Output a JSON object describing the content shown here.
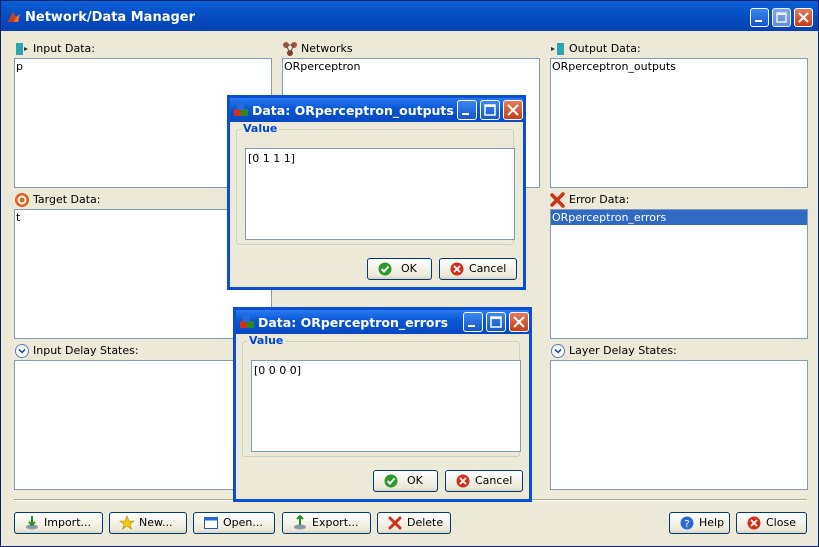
{
  "window": {
    "title": "Network/Data Manager"
  },
  "panels": {
    "input_data": {
      "label": "Input Data:",
      "items": [
        "p"
      ]
    },
    "networks": {
      "label": "Networks",
      "items": [
        "ORperceptron"
      ]
    },
    "output_data": {
      "label": "Output Data:",
      "items": [
        "ORperceptron_outputs"
      ]
    },
    "target_data": {
      "label": "Target Data:",
      "items": [
        "t"
      ]
    },
    "error_data": {
      "label": "Error Data:",
      "items": [
        "ORperceptron_errors"
      ],
      "selected": "ORperceptron_errors"
    },
    "input_delay": {
      "label": "Input Delay States:",
      "items": []
    },
    "layer_delay": {
      "label": "Layer Delay States:",
      "items": []
    }
  },
  "toolbar": {
    "import_label": "Import...",
    "new_label": "New...",
    "open_label": "Open...",
    "export_label": "Export...",
    "delete_label": "Delete",
    "help_label": "Help",
    "close_label": "Close"
  },
  "dialog_outputs": {
    "title": "Data: ORperceptron_outputs",
    "group_label": "Value",
    "value": "[0 1 1 1]",
    "ok_label": "OK",
    "cancel_label": "Cancel"
  },
  "dialog_errors": {
    "title": "Data: ORperceptron_errors",
    "group_label": "Value",
    "value": "[0 0 0 0]",
    "ok_label": "OK",
    "cancel_label": "Cancel"
  },
  "colors": {
    "titlebar": "#0750c4",
    "selection": "#316ac5",
    "group_label": "#0046d5",
    "dialog_frame": "#0a4ed2"
  },
  "icons": {
    "input": "input-arrow-icon",
    "networks": "network-icon",
    "output": "output-arrow-icon",
    "target": "target-icon",
    "error": "error-x-icon",
    "delay": "chevron-circle-icon"
  }
}
